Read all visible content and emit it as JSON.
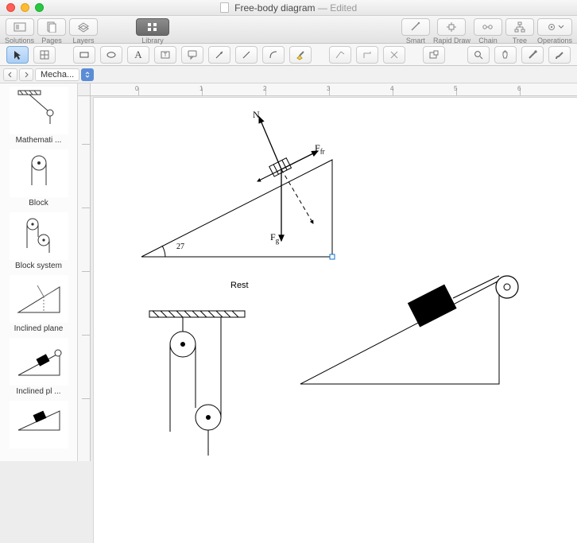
{
  "window": {
    "title": "Free-body diagram",
    "edited_suffix": " — Edited"
  },
  "toolbar": {
    "solutions": "Solutions",
    "pages": "Pages",
    "layers": "Layers",
    "library": "Library",
    "smart": "Smart",
    "rapid_draw": "Rapid Draw",
    "chain": "Chain",
    "tree": "Tree",
    "operations": "Operations"
  },
  "nav": {
    "crumb": "Mecha..."
  },
  "stencils": [
    {
      "label": "Mathemati ...",
      "kind": "math"
    },
    {
      "label": "Block",
      "kind": "block"
    },
    {
      "label": "Block system",
      "kind": "blocksys"
    },
    {
      "label": "Inclined plane",
      "kind": "incline"
    },
    {
      "label": "Inclined pl ...",
      "kind": "incline_load"
    },
    {
      "label": "",
      "kind": "incline_load2"
    }
  ],
  "diagram": {
    "angle_label": "27",
    "F_normal": "N",
    "F_friction": "F",
    "F_friction_sub": "fr",
    "F_gravity": "F",
    "F_gravity_sub": "g",
    "rest_label": "Rest"
  },
  "ruler": {
    "h_marks": [
      0,
      1,
      2,
      3,
      4,
      5,
      6
    ]
  }
}
